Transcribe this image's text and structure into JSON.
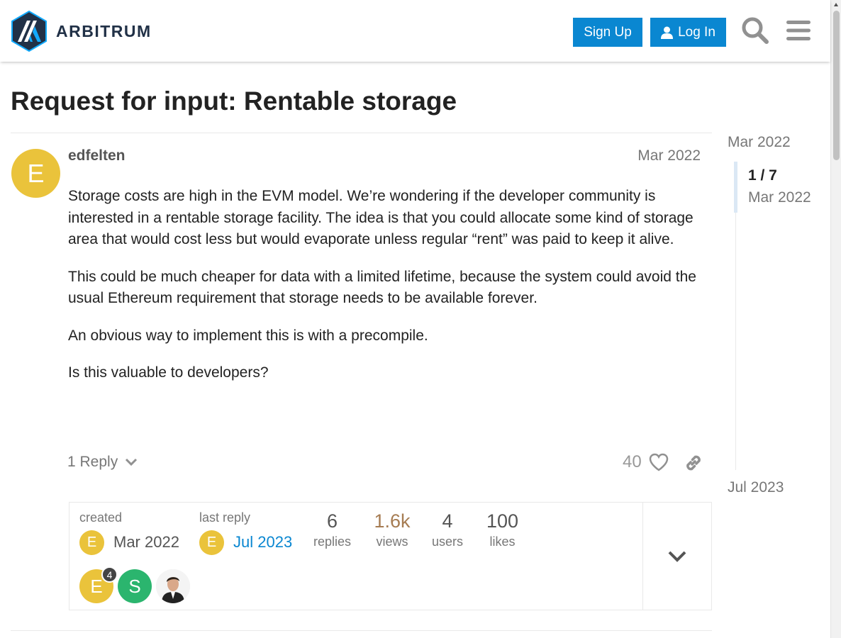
{
  "header": {
    "brand": "ARBITRUM",
    "signup_label": "Sign Up",
    "login_label": "Log In"
  },
  "topic": {
    "title": "Request for input: Rentable storage"
  },
  "post": {
    "avatar_letter": "E",
    "username": "edfelten",
    "date": "Mar 2022",
    "paragraphs": [
      "Storage costs are high in the EVM model. We’re wondering if the developer community is interested in a rentable storage facility. The idea is that you could allocate some kind of storage area that would cost less but would evaporate unless regular “rent” was paid to keep it alive.",
      "This could be much cheaper for data with a limited lifetime, because the system could avoid the usual Ethereum requirement that storage needs to be available forever.",
      "An obvious way to implement this is with a precompile.",
      "Is this valuable to developers?"
    ],
    "reply_label": "1 Reply",
    "like_count": "40"
  },
  "topic_map": {
    "created_label": "created",
    "created_avatar": "E",
    "created_date": "Mar 2022",
    "last_reply_label": "last reply",
    "last_reply_avatar": "E",
    "last_reply_date": "Jul 2023",
    "stats": [
      {
        "value": "6",
        "label": "replies"
      },
      {
        "value": "1.6k",
        "label": "views"
      },
      {
        "value": "4",
        "label": "users"
      },
      {
        "value": "100",
        "label": "likes"
      }
    ],
    "participants": [
      {
        "letter": "E",
        "color": "#eac33b",
        "badge": "4"
      },
      {
        "letter": "S",
        "color": "#2bb56e",
        "badge": ""
      },
      {
        "letter": "",
        "color": "#3a3a3a",
        "badge": ""
      }
    ]
  },
  "timeline": {
    "top_date": "Mar 2022",
    "position": "1 / 7",
    "position_date": "Mar 2022",
    "bottom_date": "Jul 2023"
  },
  "colors": {
    "primary": "#0a87d1",
    "views_accent": "#a67c52",
    "last_reply_link": "#0a87d1"
  }
}
